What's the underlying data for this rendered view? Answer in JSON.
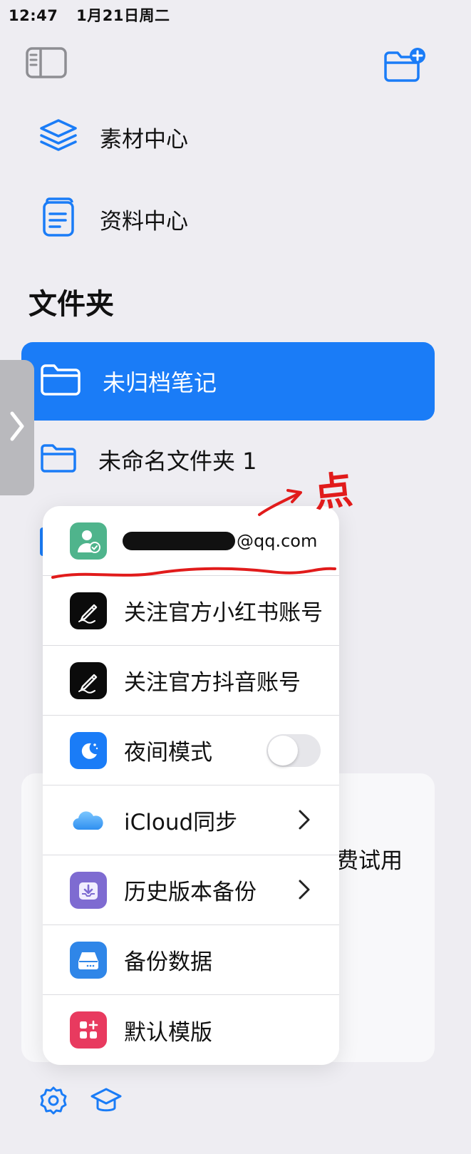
{
  "status_bar": {
    "time": "12:47",
    "date": "1月21日周二"
  },
  "toolbar": {
    "sidebar_icon": "sidebar-icon",
    "new_folder_icon": "folder-plus-icon"
  },
  "nav": {
    "items": [
      {
        "label": "素材中心",
        "icon": "layers-icon"
      },
      {
        "label": "资料中心",
        "icon": "document-icon"
      }
    ]
  },
  "folders": {
    "title": "文件夹",
    "items": [
      {
        "label": "未归档笔记",
        "selected": true
      },
      {
        "label": "未命名文件夹 1",
        "selected": false
      }
    ]
  },
  "background_card": {
    "text": "费试用"
  },
  "menu": {
    "account": {
      "email_suffix": "@qq.com"
    },
    "items": [
      {
        "label": "关注官方小红书账号",
        "icon": "pencil-app-icon"
      },
      {
        "label": "关注官方抖音账号",
        "icon": "pencil-app-icon"
      },
      {
        "label": "夜间模式",
        "icon": "moon-icon",
        "toggle_on": false
      },
      {
        "label": "iCloud同步",
        "icon": "cloud-icon",
        "chevron": true
      },
      {
        "label": "历史版本备份",
        "icon": "backup-history-icon",
        "chevron": true
      },
      {
        "label": "备份数据",
        "icon": "drive-icon"
      },
      {
        "label": "默认模版",
        "icon": "template-icon"
      }
    ]
  },
  "annotation": {
    "text": "点"
  },
  "colors": {
    "accent": "#1a7cf7",
    "background": "#eeedf2",
    "annotation": "#e11b1b",
    "account_icon": "#4fb48c",
    "night_icon": "#1a7cf7",
    "history_icon": "#7e6bd1",
    "drive_icon": "#2f86e8",
    "template_icon": "#e83a5f"
  }
}
